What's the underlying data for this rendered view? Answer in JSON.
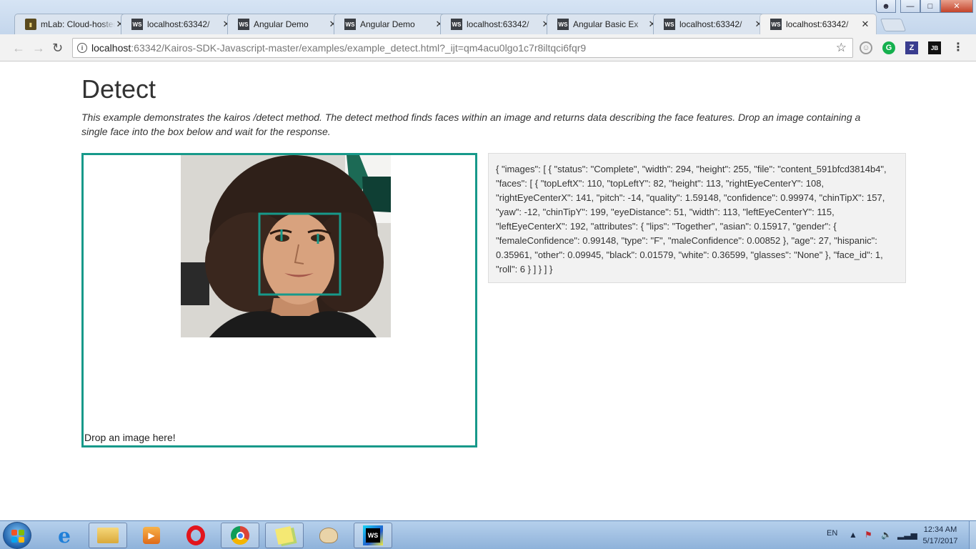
{
  "browser": {
    "tabs": [
      {
        "favicon": "mlab-favicon",
        "title": "mLab: Cloud-hosted MongoDB"
      },
      {
        "favicon": "ws-favicon",
        "title": "localhost:63342/"
      },
      {
        "favicon": "ws-favicon",
        "title": "Angular Demo"
      },
      {
        "favicon": "ws-favicon",
        "title": "Angular Demo"
      },
      {
        "favicon": "ws-favicon",
        "title": "localhost:63342/"
      },
      {
        "favicon": "ws-favicon",
        "title": "Angular Basic Ex"
      },
      {
        "favicon": "ws-favicon",
        "title": "localhost:63342/"
      },
      {
        "favicon": "ws-favicon",
        "title": "localhost:63342/"
      }
    ],
    "active_tab": 7,
    "url_host": "localhost",
    "url_rest": ":63342/Kairos-SDK-Javascript-master/examples/example_detect.html?_ijt=qm4acu0lgo1c7r8iltqci6fqr9",
    "favicon_label": "WS",
    "extensions": [
      "G",
      "Z",
      "JB"
    ]
  },
  "page": {
    "title": "Detect",
    "description": "This example demonstrates the kairos /detect method. The detect method finds faces within an image and returns data describing the face features. Drop an image containing a single face into the box below and wait for the response.",
    "drop_label": "Drop an image here!",
    "response_json": "{ \"images\": [ { \"status\": \"Complete\", \"width\": 294, \"height\": 255, \"file\": \"content_591bfcd3814b4\", \"faces\": [ { \"topLeftX\": 110, \"topLeftY\": 82, \"height\": 113, \"rightEyeCenterY\": 108, \"rightEyeCenterX\": 141, \"pitch\": -14, \"quality\": 1.59148, \"confidence\": 0.99974, \"chinTipX\": 157, \"yaw\": -12, \"chinTipY\": 199, \"eyeDistance\": 51, \"width\": 113, \"leftEyeCenterY\": 115, \"leftEyeCenterX\": 192, \"attributes\": { \"lips\": \"Together\", \"asian\": 0.15917, \"gender\": { \"femaleConfidence\": 0.99148, \"type\": \"F\", \"maleConfidence\": 0.00852 }, \"age\": 27, \"hispanic\": 0.35961, \"other\": 0.09945, \"black\": 0.01579, \"white\": 0.36599, \"glasses\": \"None\" }, \"face_id\": 1, \"roll\": 6 } ] } ] }",
    "accent_color": "#17998a"
  },
  "taskbar": {
    "language": "EN",
    "time": "12:34 AM",
    "date": "5/17/2017",
    "apps": [
      "internet-explorer-icon",
      "file-explorer-icon",
      "media-player-icon",
      "opera-icon",
      "chrome-icon",
      "sticky-notes-icon",
      "paint-icon",
      "webstorm-icon"
    ]
  }
}
